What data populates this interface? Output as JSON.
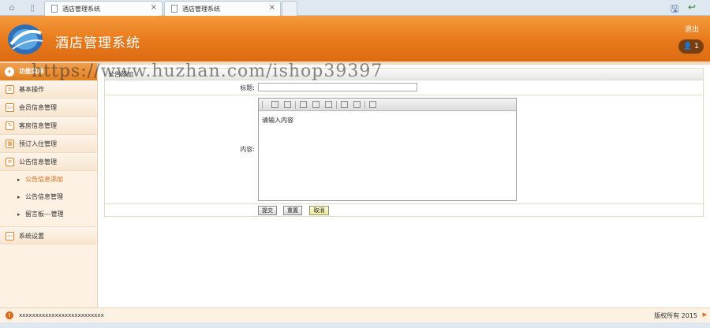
{
  "browser": {
    "tabs": [
      {
        "title": "酒店管理系统"
      },
      {
        "title": "酒店管理系统"
      }
    ],
    "close_glyph": "×"
  },
  "header": {
    "title": "酒店管理系统",
    "logout": "退出",
    "user_badge": "1"
  },
  "sidebar": {
    "heading": "功能菜单",
    "items": [
      {
        "label": "基本操作",
        "icon": "list-icon"
      },
      {
        "label": "会员信息管理",
        "icon": "card-icon"
      },
      {
        "label": "客房信息管理",
        "icon": "edit-icon"
      },
      {
        "label": "预订入住管理",
        "icon": "calendar-icon"
      },
      {
        "label": "公告信息管理",
        "icon": "list-icon"
      }
    ],
    "subitems": [
      {
        "label": "公告信息添加",
        "active": true
      },
      {
        "label": "公告信息管理",
        "active": false
      },
      {
        "label": "留言板---管理",
        "active": false
      }
    ],
    "last_item": {
      "label": "系统设置",
      "icon": "card-icon"
    }
  },
  "form": {
    "caption": "公告添加",
    "title_label": "标题:",
    "title_value": "",
    "content_label": "内容:",
    "content_placeholder": "请输入内容",
    "buttons": {
      "submit": "提交",
      "reset": "重置",
      "cancel": "取消"
    }
  },
  "footer": {
    "left_text": "xxxxxxxxxxxxxxxxxxxxxxxxxx",
    "right_text": "版权所有 2015"
  },
  "watermark": "https://www.huzhan.com/ishop39397",
  "colors": {
    "header_orange": "#e8791b",
    "sidebar_bg": "#fcf1e3",
    "active_link": "#e2650f",
    "border_green": "#d8e3c6"
  }
}
